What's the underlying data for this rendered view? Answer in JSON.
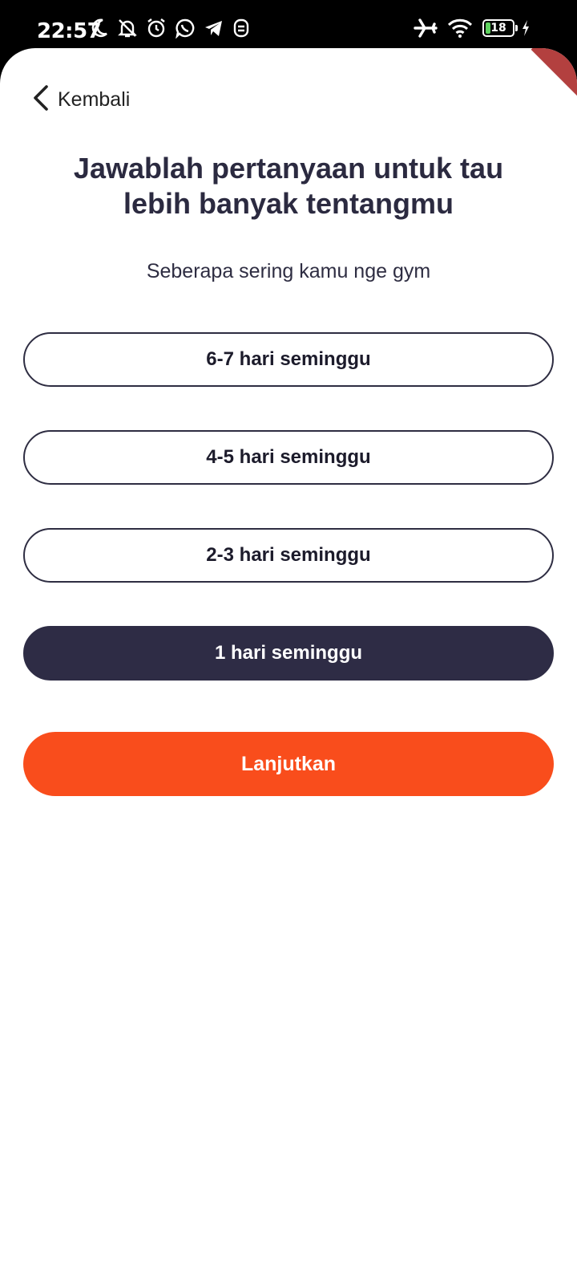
{
  "status_bar": {
    "time": "22:57",
    "battery_level": "18",
    "battery_fraction": 0.18,
    "left_icons": [
      "moon-icon",
      "bell-off-icon",
      "alarm-icon",
      "whatsapp-icon",
      "telegram-icon",
      "notification-app-icon"
    ],
    "right_icons": [
      "airplane-icon",
      "wifi-icon",
      "battery-icon",
      "charging-icon"
    ]
  },
  "header": {
    "back_label": "Kembali"
  },
  "title": {
    "line1": "Jawablah pertanyaan untuk tau",
    "line2": "lebih banyak tentangmu"
  },
  "question": "Seberapa sering kamu nge gym",
  "options": [
    {
      "label": "6-7 hari seminggu",
      "selected": false
    },
    {
      "label": "4-5 hari seminggu",
      "selected": false
    },
    {
      "label": "2-3 hari seminggu",
      "selected": false
    },
    {
      "label": "1 hari seminggu",
      "selected": true
    }
  ],
  "continue_label": "Lanjutkan",
  "colors": {
    "accent": "#f94d1c",
    "selected": "#2e2c45",
    "text_dark": "#2b2a40"
  }
}
